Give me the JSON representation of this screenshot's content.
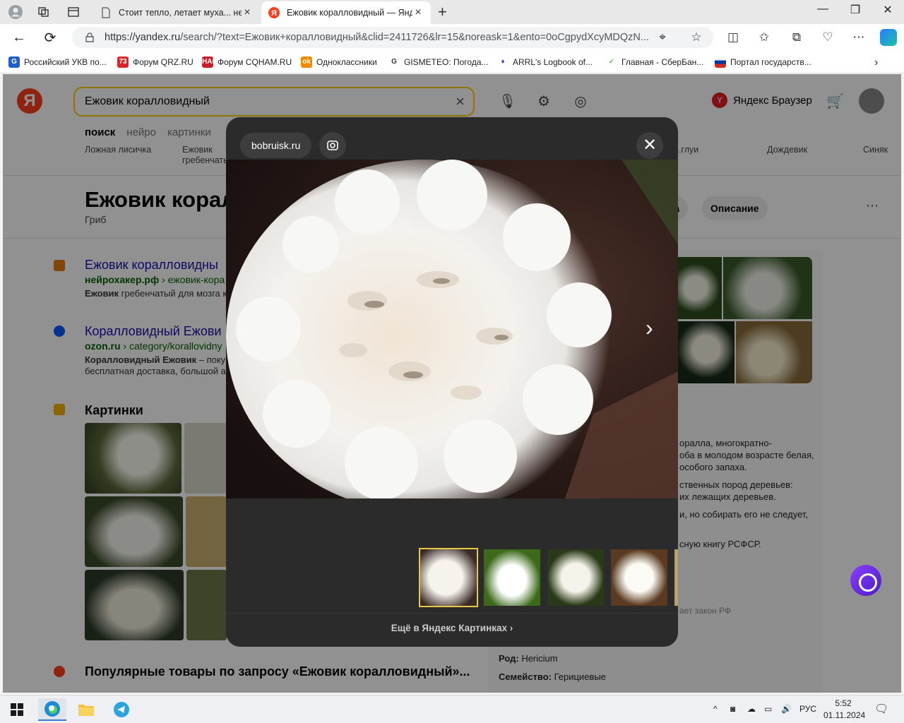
{
  "browser": {
    "tabs": [
      {
        "title": "Стоит тепло, летает муха... неуж",
        "active": false
      },
      {
        "title": "Ежовик коралловидный — Янде",
        "active": true
      }
    ],
    "url_main": "https://yandex.ru",
    "url_rest": "/search/?text=Ежовик+коралловидный&clid=2411726&lr=15&noreask=1&ento=0oCgpydXcyMDQzN...",
    "bookmarks": [
      "Российский УКВ по...",
      "Форум QRZ.RU",
      "Форум CQHAM.RU",
      "Одноклассники",
      "GISMETEO: Погода...",
      "ARRL's Logbook of...",
      "Главная - СберБан...",
      "Портал государств..."
    ]
  },
  "page": {
    "search_query": "Ежовик коралловидный",
    "yandex_browser_label": "Яндекс Браузер",
    "search_tabs": [
      "поиск",
      "нейро",
      "картинки"
    ],
    "chips": [
      {
        "line1": "Ложная лисичка",
        "line2": ""
      },
      {
        "line1": "Ежовик",
        "line2": "гребенчатый"
      }
    ],
    "chips_right": [
      "...глуи",
      "Дождевик",
      "Синяк"
    ],
    "entity_title": "Ежовик корал",
    "entity_subtitle": "Гриб",
    "pills": [
      "ва",
      "Описание"
    ],
    "results": [
      {
        "title": "Ежовик коралловидны",
        "url_host": "нейрохакер.рф",
        "url_path": "ежовик-кора",
        "snippet_bold": "Ежовик",
        "snippet": " гребенчатый для мозга к"
      },
      {
        "title": "Коралловидный Ежови",
        "url_host": "ozon.ru",
        "url_path": "category/korallovidny",
        "snippet_bold": "Коралловидный Ежовик",
        "snippet": " – покуп",
        "snippet2": "бесплатная доставка, большой ас"
      }
    ],
    "pictures_title": "Картинки",
    "popular_title": "Популярные товары по запросу «Ежовик коралловидный»...",
    "side_text": [
      "оралла, многократно-",
      "оба в молодом возрасте белая,",
      "особого запаха.",
      "ственных пород деревьев:",
      "их лежащих деревьев.",
      "и, но собирать его не следует,",
      "сную книгу РСФСР."
    ],
    "side_gray": "ает закон РФ",
    "kv": [
      {
        "key": "Род:",
        "value": " Hericium"
      },
      {
        "key": "Семейство:",
        "value": " Герициевые"
      }
    ]
  },
  "viewer": {
    "source": "bobruisk.ru",
    "more_link": "Ещё в Яндекс Картинках ›"
  },
  "taskbar": {
    "lang": "РУС",
    "time": "5:52",
    "date": "01.11.2024"
  }
}
